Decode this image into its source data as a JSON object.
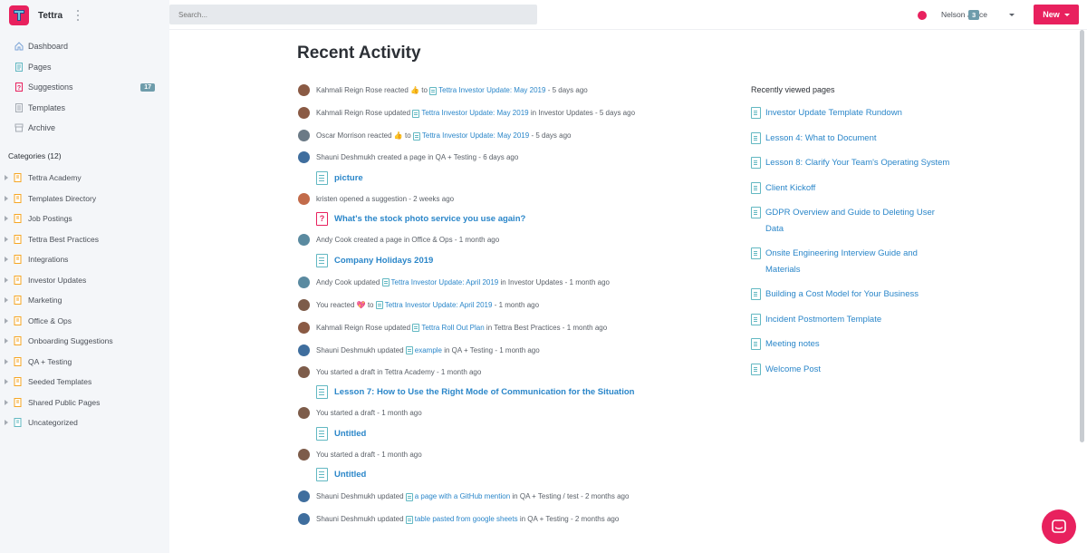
{
  "app": {
    "name": "Tettra"
  },
  "search": {
    "placeholder": "Search..."
  },
  "user": {
    "name": "Nelson Joyce",
    "count": "3"
  },
  "new_button": {
    "label": "New"
  },
  "nav": [
    {
      "label": "Dashboard",
      "icon": "home-icon"
    },
    {
      "label": "Pages",
      "icon": "page-icon"
    },
    {
      "label": "Suggestions",
      "icon": "question-icon",
      "badge": "17"
    },
    {
      "label": "Templates",
      "icon": "template-icon"
    },
    {
      "label": "Archive",
      "icon": "archive-icon"
    }
  ],
  "categories": {
    "heading": "Categories (12)",
    "items": [
      "Tettra Academy",
      "Templates Directory",
      "Job Postings",
      "Tettra Best Practices",
      "Integrations",
      "Investor Updates",
      "Marketing",
      "Office & Ops",
      "Onboarding Suggestions",
      "QA + Testing",
      "Seeded Templates",
      "Shared Public Pages",
      "Uncategorized"
    ]
  },
  "main": {
    "title": "Recent Activity",
    "activities": [
      {
        "pre": "Kahmali Reign Rose reacted 👍 to",
        "link": "Tettra Investor Update: May 2019",
        "post": "- 5 days ago"
      },
      {
        "pre": "Kahmali Reign Rose updated",
        "link": "Tettra Investor Update: May 2019",
        "post": "in Investor Updates - 5 days ago"
      },
      {
        "pre": "Oscar Morrison reacted 👍 to",
        "link": "Tettra Investor Update: May 2019",
        "post": "- 5 days ago"
      },
      {
        "pre": "Shauni Deshmukh created a page in QA + Testing - 6 days ago",
        "child": "picture"
      },
      {
        "pre": "kristen opened a suggestion - 2 weeks ago",
        "child": "What's the stock photo service you use again?"
      },
      {
        "pre": "Andy Cook created a page in Office & Ops - 1 month ago",
        "child": "Company Holidays 2019"
      },
      {
        "pre": "Andy Cook updated",
        "link": "Tettra Investor Update: April 2019",
        "post": "in Investor Updates - 1 month ago"
      },
      {
        "pre": "You reacted 💖 to",
        "link": "Tettra Investor Update: April 2019",
        "post": "- 1 month ago"
      },
      {
        "pre": "Kahmali Reign Rose updated",
        "link": "Tettra Roll Out Plan",
        "post": "in Tettra Best Practices - 1 month ago"
      },
      {
        "pre": "Shauni Deshmukh updated",
        "link": "example",
        "post": "in QA + Testing - 1 month ago"
      },
      {
        "pre": "You started a draft in Tettra Academy - 1 month ago",
        "child": "Lesson 7: How to Use the Right Mode of Communication for the Situation"
      },
      {
        "pre": "You started a draft - 1 month ago",
        "child": "Untitled"
      },
      {
        "pre": "You started a draft - 1 month ago",
        "child": "Untitled"
      },
      {
        "pre": "Shauni Deshmukh updated",
        "link": "a page with a GitHub mention",
        "post": "in QA + Testing / test - 2 months ago"
      },
      {
        "pre": "Shauni Deshmukh updated",
        "link": "table pasted from google sheets",
        "post": "in QA + Testing - 2 months ago"
      }
    ]
  },
  "recently_viewed": {
    "heading": "Recently viewed pages",
    "items": [
      "Investor Update Template Rundown",
      "Lesson 4: What to Document",
      "Lesson 8: Clarify Your Team's Operating System",
      "Client Kickoff",
      "GDPR Overview and Guide to Deleting User Data",
      "Onsite Engineering Interview Guide and Materials",
      "Building a Cost Model for Your Business",
      "Incident Postmortem Template",
      "Meeting notes",
      "Welcome Post"
    ]
  },
  "colors": {
    "brand": "#e8215e",
    "link": "#2a86c9",
    "page_icon": "#62b8c2",
    "badge": "#6e9cab"
  }
}
